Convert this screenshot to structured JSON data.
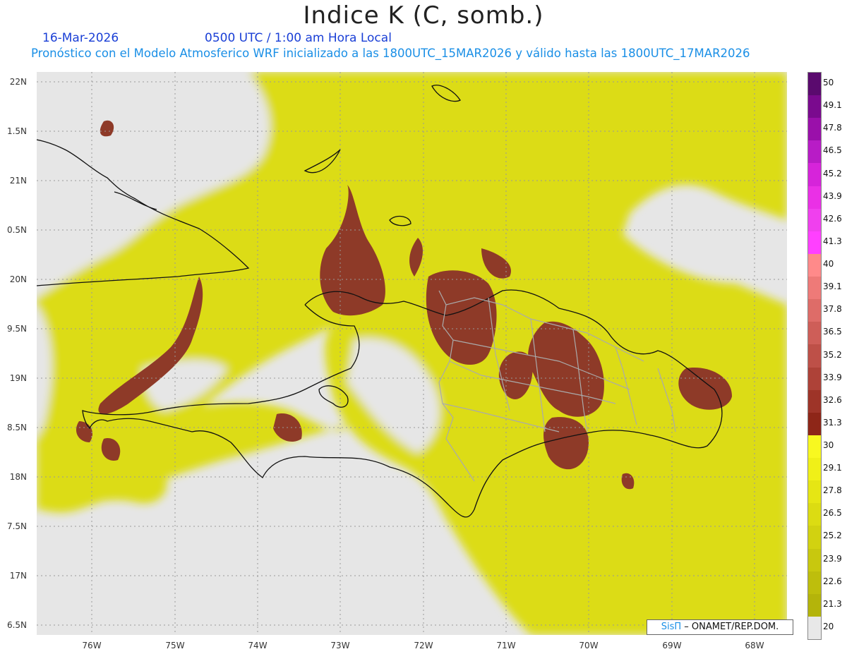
{
  "title": "Indice K (C, somb.)",
  "date": "16-Mar-2026",
  "valid_time": "0500 UTC / 1:00 am Hora Local",
  "description": "Pronóstico con el Modelo Atmosferico WRF inicializado a las 1800UTC_15MAR2026 y válido hasta las  1800UTC_17MAR2026",
  "credit": {
    "brand": "SisΠ",
    "text": " – ONAMET/REP.DOM."
  },
  "latitude_labels": [
    "22N",
    "1.5N",
    "21N",
    "0.5N",
    "20N",
    "9.5N",
    "19N",
    "8.5N",
    "18N",
    "7.5N",
    "17N",
    "6.5N"
  ],
  "longitude_labels": [
    "76W",
    "75W",
    "74W",
    "73W",
    "72W",
    "71W",
    "70W",
    "69W",
    "68W"
  ],
  "legend": {
    "labels": [
      "50",
      "49.1",
      "47.8",
      "46.5",
      "45.2",
      "43.9",
      "42.6",
      "41.3",
      "40",
      "39.1",
      "37.8",
      "36.5",
      "35.2",
      "33.9",
      "32.6",
      "31.3",
      "30",
      "29.1",
      "27.8",
      "26.5",
      "25.2",
      "23.9",
      "22.6",
      "21.3",
      "20"
    ],
    "colors": [
      "#5a0a6e",
      "#7a0a8e",
      "#9a10aa",
      "#b81cc6",
      "#d624da",
      "#ea30e6",
      "#f040ee",
      "#ff40ff",
      "#ff8a8a",
      "#ee7a78",
      "#de6c68",
      "#ce5e58",
      "#be5048",
      "#ae4238",
      "#9e3428",
      "#8e2618",
      "#f8f820",
      "#f0f018",
      "#e6e614",
      "#dcdc12",
      "#d2d210",
      "#c8c80e",
      "#bebe0c",
      "#b4b40a",
      "#e8e8e8"
    ]
  },
  "map_colors": {
    "ocean_low": "#e6e6e6",
    "k_20_30": "#dede1a",
    "k_30_40": "#8e3a28",
    "coast": "#111111",
    "provinces": "#aaaaaa"
  }
}
